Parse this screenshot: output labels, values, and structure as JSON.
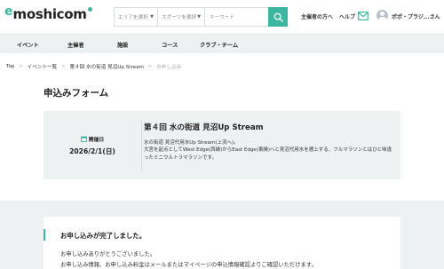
{
  "brand": {
    "logo_e": "e",
    "logo_text": "moshicom",
    "accent": "#3cb6a0"
  },
  "search": {
    "area_placeholder": "エリアを選択",
    "sport_placeholder": "スポーツを選択",
    "keyword_placeholder": "キーワード"
  },
  "header": {
    "organizer_link": "主催者の方へ",
    "help_link": "ヘルプ",
    "username": "ポポ・プラジ...さん"
  },
  "nav": {
    "items": [
      "イベント",
      "主催者",
      "施設",
      "コース",
      "クラブ・チーム"
    ]
  },
  "breadcrumb": {
    "items": [
      "Top",
      "イベント一覧",
      "第４回 水の街道 見沼Up Stream",
      "お申し込み"
    ]
  },
  "page_title": "申込みフォーム",
  "event": {
    "date_label": "開催日",
    "date_value": "2026/2/1(日)",
    "title": "第４回 水の街道 見沼Up Stream",
    "desc_line1": "水の街道 見沼代用水Up Stream(上流へ)。",
    "desc_line2": "大宮を起点としてWest Edge(西縁)からEast Edge(東縁)へと見沼代用水を遡上する、フルマラソンとはひと味違ったミニウルトラマラソンです。"
  },
  "notice": {
    "title": "お申し込みが完了しました。",
    "line1": "お申し込みありがとうございました。",
    "line2": "お申し込み情報、お申し込み料金はメールまたはマイページの申込情報確認よりご確認いただけます。"
  }
}
